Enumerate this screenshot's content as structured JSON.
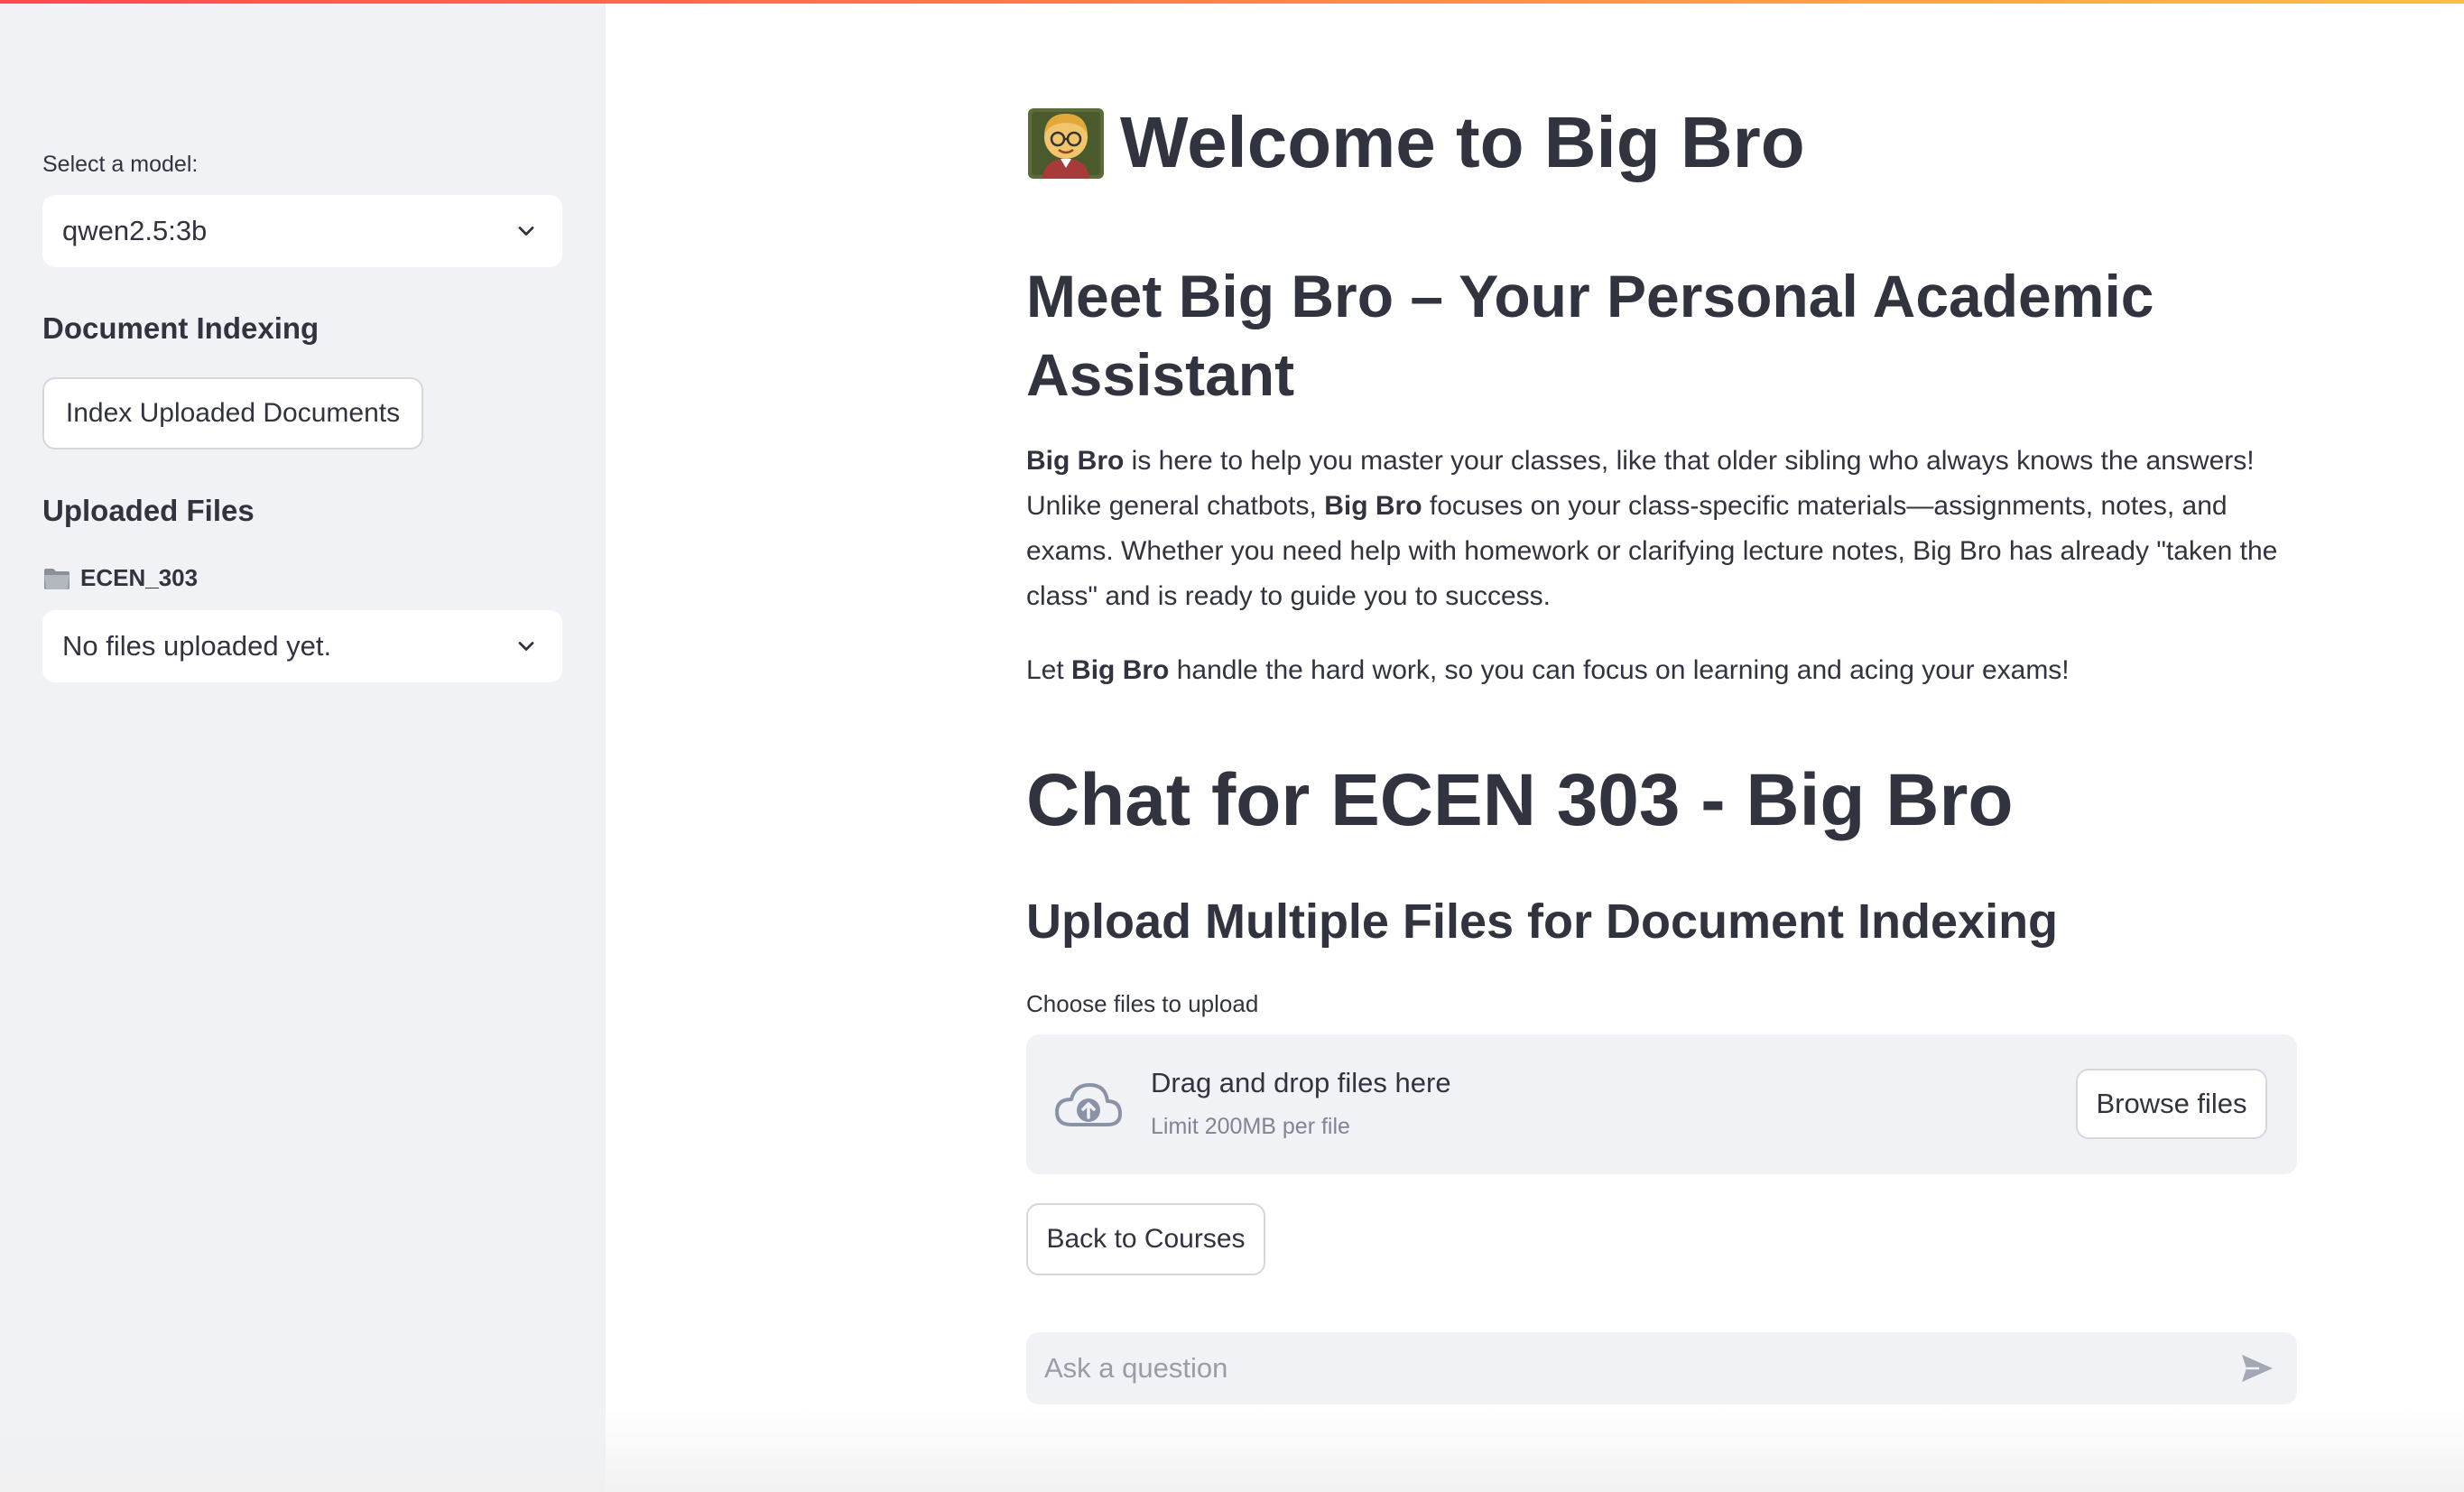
{
  "colors": {
    "sidebar_bg": "#f0f2f6",
    "text": "#31333f",
    "muted": "#808495",
    "accent_gradient": [
      "#ff4b4b",
      "#ffbd45"
    ]
  },
  "sidebar": {
    "model_label": "Select a model:",
    "model_selected": "qwen2.5:3b",
    "indexing_heading": "Document Indexing",
    "index_button": "Index Uploaded Documents",
    "uploaded_heading": "Uploaded Files",
    "folder_icon": "folder-icon",
    "folder_name": "ECEN_303",
    "files_dropdown": "No files uploaded yet."
  },
  "main": {
    "title_emoji": "teacher-emoji",
    "title": "Welcome to Big Bro",
    "subtitle": "Meet Big Bro – Your Personal Academic Assistant",
    "intro": {
      "p1_bold1": "Big Bro",
      "p1_text1": " is here to help you master your classes, like that older sibling who always knows the answers! Unlike general chatbots, ",
      "p1_bold2": "Big Bro",
      "p1_text2": " focuses on your class-specific materials—assignments, notes, and exams. Whether you need help with homework or clarifying lecture notes, Big Bro has already \"taken the class\" and is ready to guide you to success.",
      "p2_text1": "Let ",
      "p2_bold": "Big Bro",
      "p2_text2": " handle the hard work, so you can focus on learning and acing your exams!"
    },
    "chat_heading": "Chat for ECEN 303 - Big Bro",
    "upload_heading": "Upload Multiple Files for Document Indexing",
    "uploader": {
      "label": "Choose files to upload",
      "dropzone_title": "Drag and drop files here",
      "dropzone_limit": "Limit 200MB per file",
      "browse_button": "Browse files",
      "icon": "cloud-upload-icon"
    },
    "back_button": "Back to Courses",
    "chat_input_placeholder": "Ask a question",
    "send_icon": "send-icon"
  }
}
